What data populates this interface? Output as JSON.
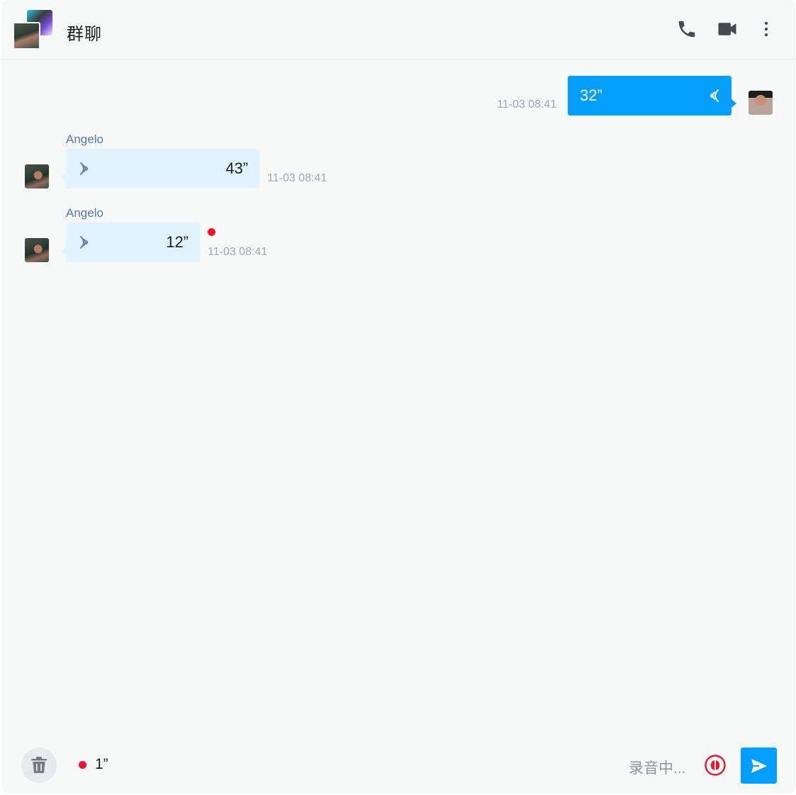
{
  "header": {
    "title": "群聊",
    "icons": [
      "phone-icon",
      "video-camera-icon",
      "more-vertical-icon"
    ]
  },
  "messages": [
    {
      "direction": "outgoing",
      "sender": "",
      "duration": "32”",
      "time": "11-03 08:41",
      "unread": false
    },
    {
      "direction": "incoming",
      "sender": "Angelo",
      "duration": "43”",
      "time": "11-03 08:41",
      "unread": false
    },
    {
      "direction": "incoming",
      "sender": "Angelo",
      "duration": "12”",
      "time": "11-03 08:41",
      "unread": true
    }
  ],
  "footer": {
    "recording_time": "1”",
    "recording_status": "录音中...",
    "icons": [
      "trash-icon",
      "pause-icon",
      "send-icon"
    ]
  },
  "colors": {
    "accent": "#039eff",
    "incoming_bubble": "#e0f3ff",
    "unread": "#ee1233",
    "sender_name": "#5a78ad"
  }
}
